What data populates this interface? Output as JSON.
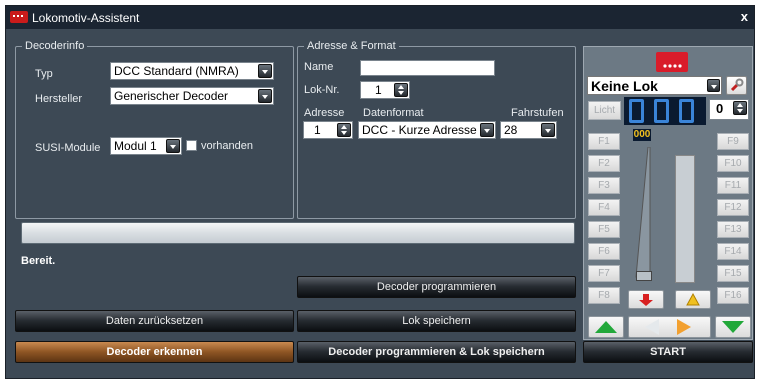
{
  "window": {
    "title": "Lokomotiv-Assistent",
    "close": "x"
  },
  "decoderinfo": {
    "legend": "Decoderinfo",
    "typ_label": "Typ",
    "typ_value": "DCC Standard (NMRA)",
    "hersteller_label": "Hersteller",
    "hersteller_value": "Generischer Decoder",
    "susi_label": "SUSI-Module",
    "susi_value": "Modul 1",
    "vorhanden_label": "vorhanden"
  },
  "address": {
    "legend": "Adresse & Format",
    "name_label": "Name",
    "name_value": "",
    "loknr_label": "Lok-Nr.",
    "loknr_value": "1",
    "adresse_label": "Adresse",
    "adresse_value": "1",
    "datenformat_label": "Datenformat",
    "datenformat_value": "DCC - Kurze Adresse",
    "fahrstufen_label": "Fahrstufen",
    "fahrstufen_value": "28"
  },
  "status": "Bereit.",
  "progress": 0,
  "buttons": {
    "decoder_programmieren": "Decoder programmieren",
    "daten_zuruecksetzen": "Daten zurücksetzen",
    "lok_speichern": "Lok speichern",
    "decoder_erkennen": "Decoder erkennen",
    "prog_und_speichern": "Decoder programmieren & Lok speichern",
    "start": "START"
  },
  "control": {
    "lok_select": "Keine Lok",
    "licht": "Licht",
    "speed_display": "000",
    "step_value": "0",
    "small_display": "000",
    "f_left": [
      "F1",
      "F2",
      "F3",
      "F4",
      "F5",
      "F6",
      "F7",
      "F8"
    ],
    "f_right": [
      "F9",
      "F10",
      "F11",
      "F12",
      "F13",
      "F14",
      "F15",
      "F16"
    ],
    "speed_level": 0
  },
  "colors": {
    "accent": "#c98a50",
    "window_bg": "#3d4955",
    "titlebar": "#1b2532",
    "brand_red": "#c91b1b"
  },
  "icons": {
    "brand": "dots-logo-icon",
    "settings": "wrench-icon",
    "forward": "arrow-up-green-icon",
    "backward": "arrow-down-green-icon",
    "stop": "arrow-down-red-icon",
    "warning": "warning-icon",
    "direction": "direction-arrow-icon"
  }
}
